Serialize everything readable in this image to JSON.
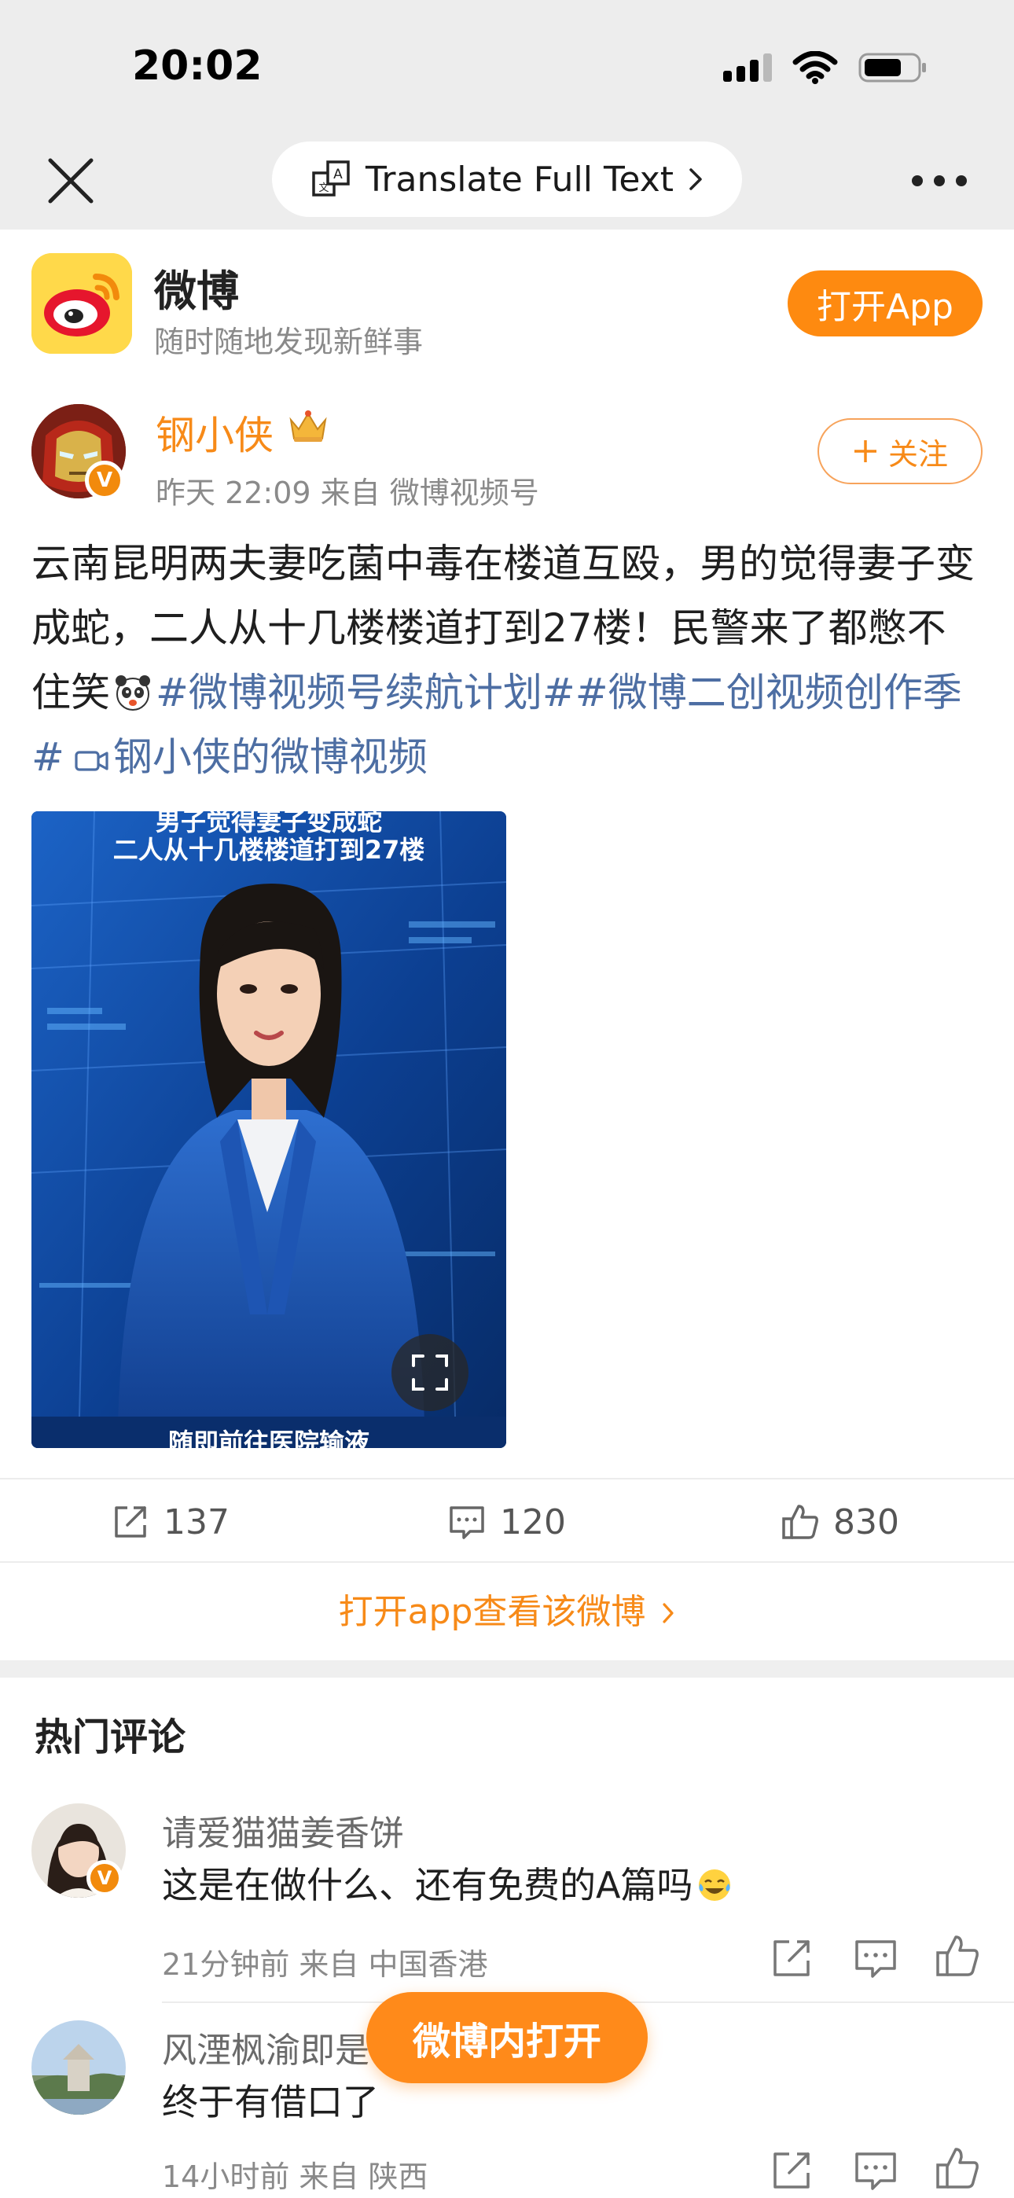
{
  "status_bar": {
    "time": "20:02"
  },
  "toolbar": {
    "translate_label": "Translate Full Text"
  },
  "app_banner": {
    "name": "微博",
    "slogan": "随时随地发现新鲜事",
    "open_button": "打开App"
  },
  "post": {
    "author": "钢小侠",
    "meta": "昨天 22:09 来自 微博视频号",
    "follow_label": "关注",
    "text_main": "云南昆明两夫妻吃菌中毒在楼道互殴，男的觉得妻子变成蛇，二人从十几楼楼道打到27楼！民警来了都憋不住笑",
    "tag_1": "#微博视频号续航计划#",
    "tag_2": "#微博二创视频创作季#",
    "video_link": "钢小侠的微博视频",
    "video": {
      "caption_top_1": "男子觉得妻子变成蛇",
      "caption_top_2": "二人从十几楼楼道打到27楼",
      "caption_bottom": "随即前往医院输液"
    },
    "actions": {
      "reposts": "137",
      "comments": "120",
      "likes": "830"
    },
    "open_in_app": "打开app查看该微博"
  },
  "comments_section": {
    "title": "热门评论",
    "items": [
      {
        "name": "请爱猫猫姜香饼",
        "text": "这是在做什么、还有免费的A篇吗",
        "meta": "21分钟前 来自 中国香港"
      },
      {
        "name": "风湮枫渝即是",
        "text": "终于有借口了",
        "meta": "14小时前 来自 陕西"
      }
    ]
  },
  "floating_button": "微博内打开",
  "colors": {
    "accent": "#fe8a10",
    "tag_blue": "#4d6ea3",
    "gray_text": "#8a8a8a"
  }
}
